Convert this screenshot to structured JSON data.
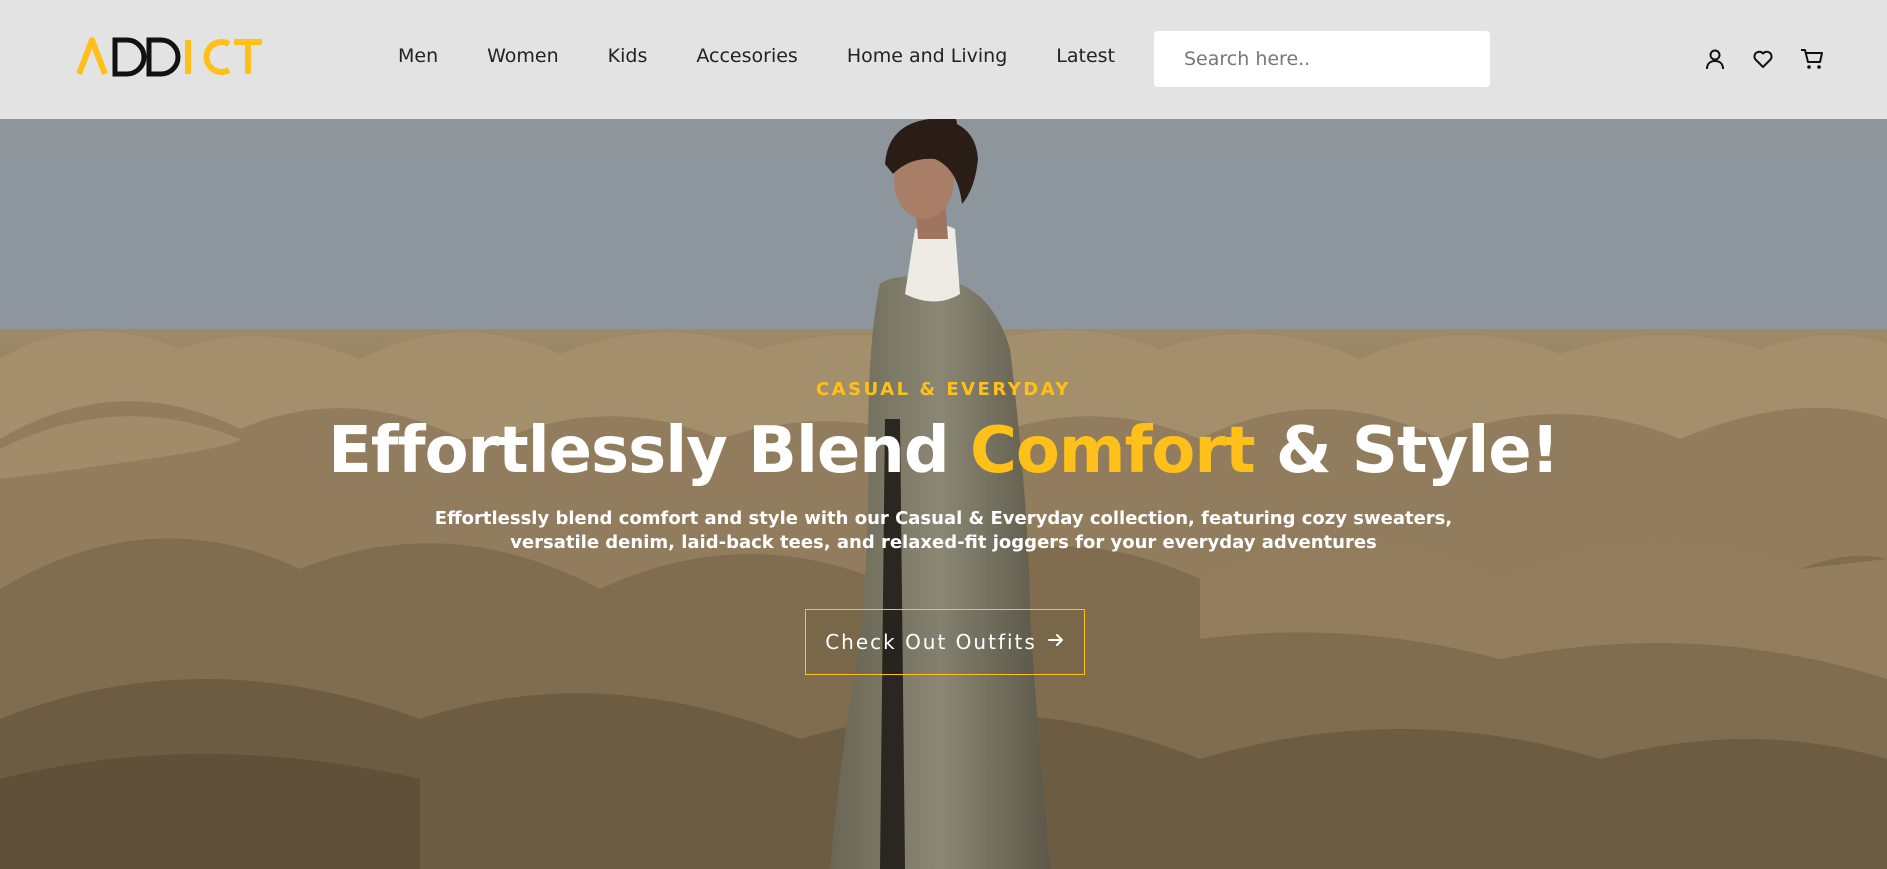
{
  "brand": {
    "logo_text": "ADDICT",
    "accent_color": "#ffc01a"
  },
  "nav": {
    "links": [
      {
        "label": "Men"
      },
      {
        "label": "Women"
      },
      {
        "label": "Kids"
      },
      {
        "label": "Accesories"
      },
      {
        "label": "Home and Living"
      },
      {
        "label": "Latest"
      }
    ]
  },
  "search": {
    "placeholder": "Search here.."
  },
  "header_icons": [
    "user-icon",
    "heart-icon",
    "cart-icon"
  ],
  "hero": {
    "eyebrow": "CASUAL & EVERYDAY",
    "headline_start": "Effortlessly Blend ",
    "headline_accent": "Comfort",
    "headline_end": " & Style!",
    "subtext": "Effortlessly blend comfort and style with our Casual & Everyday collection, featuring cozy sweaters, versatile denim, laid-back tees, and relaxed-fit joggers for your everyday adventures",
    "cta_label": "Check Out Outfits",
    "cta_icon": "arrow-right-icon"
  }
}
